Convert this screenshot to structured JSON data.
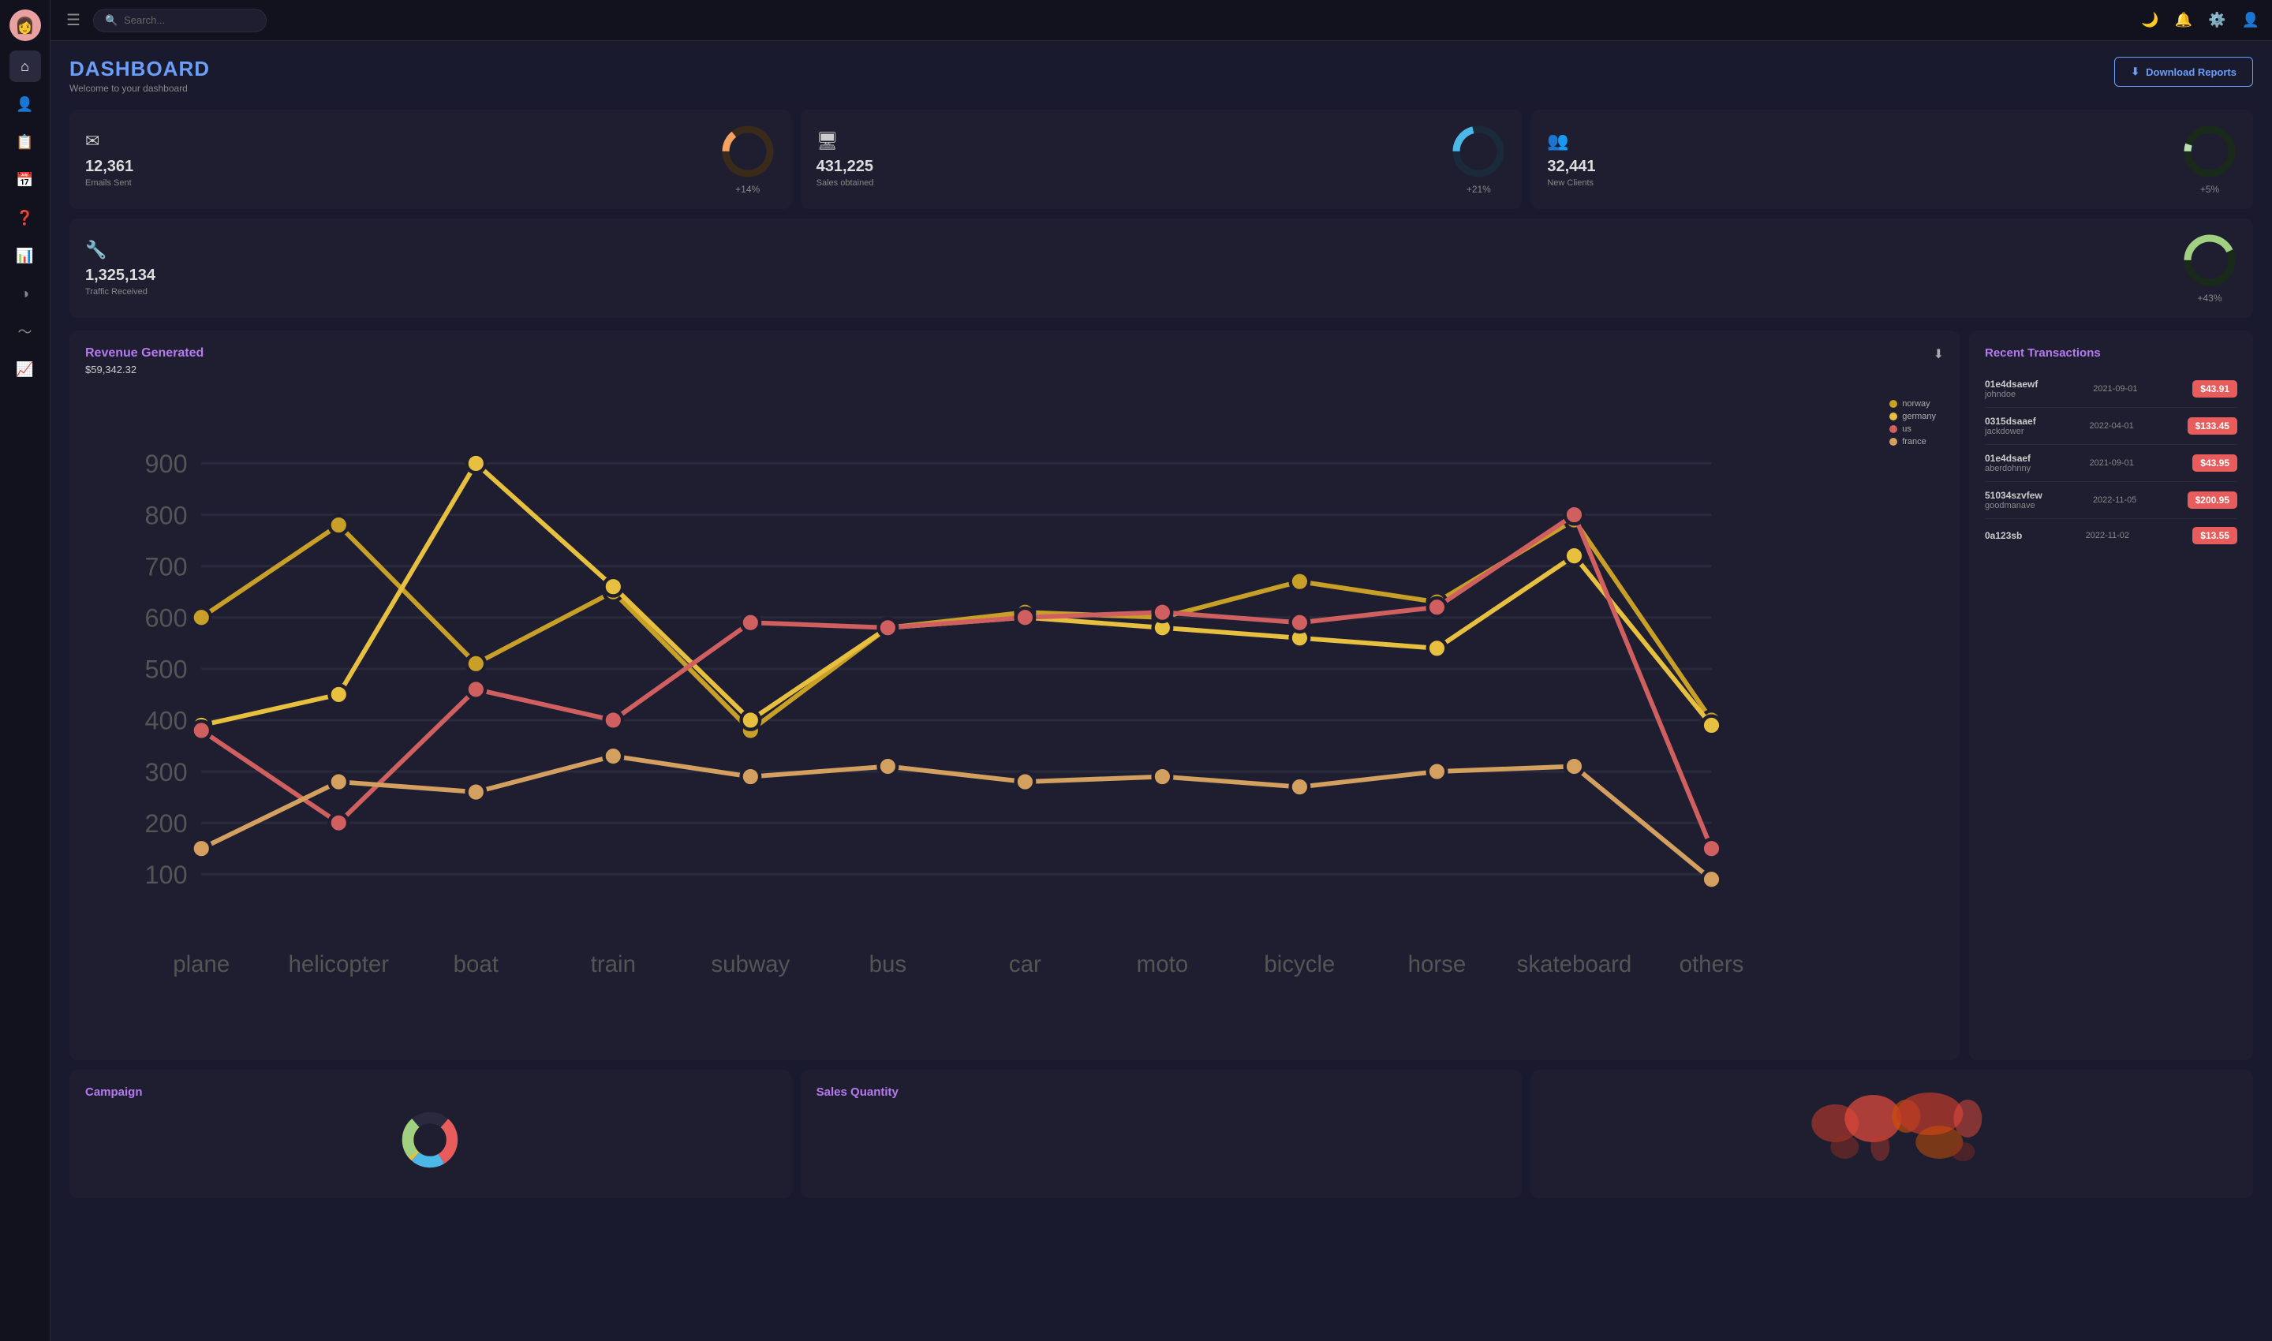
{
  "sidebar": {
    "avatar_emoji": "👩",
    "items": [
      {
        "name": "home",
        "icon": "⌂",
        "active": true
      },
      {
        "name": "users",
        "icon": "👤"
      },
      {
        "name": "contacts",
        "icon": "📋"
      },
      {
        "name": "calendar",
        "icon": "📅"
      },
      {
        "name": "help",
        "icon": "❓"
      },
      {
        "name": "analytics",
        "icon": "📊"
      },
      {
        "name": "pie",
        "icon": "◑"
      },
      {
        "name": "trends",
        "icon": "〜"
      },
      {
        "name": "reports",
        "icon": "📈"
      }
    ]
  },
  "topnav": {
    "hamburger": "☰",
    "search_placeholder": "Search...",
    "icons": [
      "🌙",
      "🔔",
      "⚙️",
      "👤"
    ]
  },
  "header": {
    "title": "DASHBOARD",
    "subtitle": "Welcome to your dashboard",
    "download_btn": "Download Reports"
  },
  "stats": [
    {
      "icon": "✉",
      "value": "12,361",
      "label": "Emails Sent",
      "percent": "+14%",
      "donut_color": "#f4a261",
      "donut_bg": "#3a2a1a",
      "donut_pct": 14
    },
    {
      "icon": "🖥",
      "value": "431,225",
      "label": "Sales obtained",
      "percent": "+21%",
      "donut_color": "#4db8e8",
      "donut_bg": "#1a2a3a",
      "donut_pct": 21
    },
    {
      "icon": "👥",
      "value": "32,441",
      "label": "New Clients",
      "percent": "+5%",
      "donut_color": "#b8e0b0",
      "donut_bg": "#1a2a1a",
      "donut_pct": 5
    }
  ],
  "traffic_stat": {
    "icon": "🔧",
    "value": "1,325,134",
    "label": "Traffic Received",
    "percent": "+43%",
    "donut_color": "#a0d080",
    "donut_bg": "#1a2a1a",
    "donut_pct": 43
  },
  "revenue_chart": {
    "title": "Revenue Generated",
    "amount": "$59,342.32",
    "x_labels": [
      "plane",
      "helicopter",
      "boat",
      "train",
      "subway",
      "bus",
      "car",
      "moto",
      "bicycle",
      "horse",
      "skateboard",
      "others"
    ],
    "series": [
      {
        "name": "norway",
        "color": "#c8a028",
        "values": [
          600,
          780,
          510,
          650,
          380,
          580,
          610,
          600,
          670,
          630,
          790,
          400
        ]
      },
      {
        "name": "germany",
        "color": "#e8c040",
        "values": [
          390,
          450,
          900,
          660,
          400,
          580,
          600,
          580,
          560,
          540,
          720,
          390
        ]
      },
      {
        "name": "us",
        "color": "#d06060",
        "values": [
          380,
          200,
          460,
          400,
          590,
          580,
          600,
          610,
          590,
          620,
          800,
          150
        ]
      },
      {
        "name": "france",
        "color": "#d4a060",
        "values": [
          150,
          280,
          260,
          330,
          290,
          310,
          280,
          290,
          270,
          300,
          310,
          90
        ]
      }
    ],
    "y_labels": [
      "100",
      "200",
      "300",
      "400",
      "500",
      "600",
      "700",
      "800",
      "900"
    ]
  },
  "transactions": {
    "title": "Recent Transactions",
    "items": [
      {
        "id": "01e4dsaewf",
        "user": "johndoe",
        "date": "2021-09-01",
        "amount": "$43.91"
      },
      {
        "id": "0315dsaaef",
        "user": "jackdower",
        "date": "2022-04-01",
        "amount": "$133.45"
      },
      {
        "id": "01e4dsaef",
        "user": "aberdohnny",
        "date": "2021-09-01",
        "amount": "$43.95"
      },
      {
        "id": "51034szvfew",
        "user": "goodmanave",
        "date": "2022-11-05",
        "amount": "$200.95"
      },
      {
        "id": "0a123sb",
        "user": "",
        "date": "2022-11-02",
        "amount": "$13.55"
      }
    ]
  },
  "bottom": {
    "campaign_title": "Campaign",
    "sales_title": "Sales Quantity",
    "map_title": ""
  }
}
